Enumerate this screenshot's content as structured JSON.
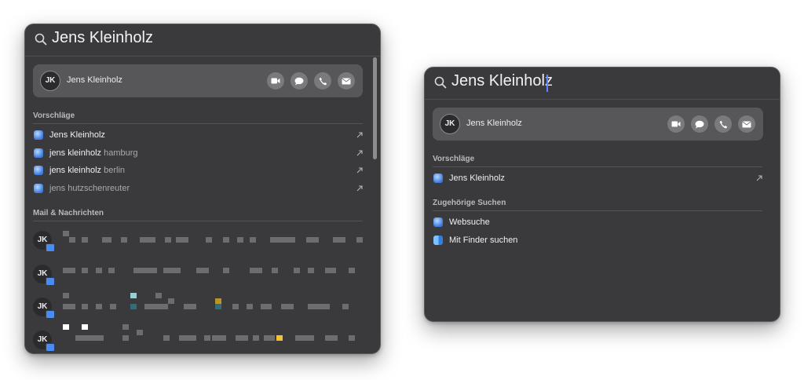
{
  "left_window": {
    "query": "Jens Kleinholz",
    "contact": {
      "initials": "JK",
      "name": "Jens Kleinholz"
    },
    "section_suggestions": "Vorschläge",
    "suggestions": [
      {
        "bold": "Jens Kleinholz",
        "rest": ""
      },
      {
        "bold": "jens kleinholz",
        "rest": " hamburg"
      },
      {
        "bold": "jens kleinholz",
        "rest": " berlin"
      },
      {
        "bold": "",
        "rest": "jens hutzschenreuter"
      }
    ],
    "section_mail": "Mail & Nachrichten",
    "mail_items": [
      {
        "initials": "JK"
      },
      {
        "initials": "JK"
      },
      {
        "initials": "JK"
      },
      {
        "initials": "JK"
      }
    ]
  },
  "right_window": {
    "query": "Jens Kleinholz",
    "contact": {
      "initials": "JK",
      "name": "Jens Kleinholz"
    },
    "section_suggestions": "Vorschläge",
    "suggestions": [
      {
        "bold": "Jens Kleinholz",
        "rest": ""
      }
    ],
    "section_related": "Zugehörige Suchen",
    "related": [
      {
        "label": "Websuche",
        "icon": "safari-icon"
      },
      {
        "label": "Mit Finder suchen",
        "icon": "finder-icon"
      }
    ]
  },
  "colors": {
    "panel": "#3a3a3c",
    "card": "#57575a",
    "accent": "#5d86ff",
    "highlight_yellow": "#f2c230",
    "highlight_teal": "#8fd3d8"
  },
  "icons": [
    "search-icon",
    "video-icon",
    "message-icon",
    "phone-icon",
    "mail-icon",
    "arrow-up-right-icon",
    "safari-icon",
    "finder-icon",
    "mail-badge-icon"
  ]
}
